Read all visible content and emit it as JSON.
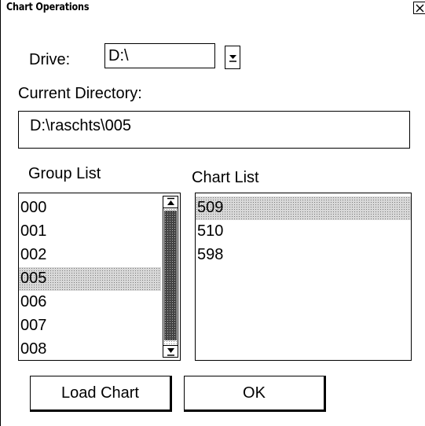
{
  "window": {
    "title": "Chart Operations"
  },
  "drive": {
    "label": "Drive:",
    "value": "D:\\",
    "dropdown_icon": "dropdown-arrow-icon"
  },
  "current_directory": {
    "label": "Current Directory:",
    "value": "D:\\raschts\\005"
  },
  "group_list": {
    "label": "Group List",
    "items": [
      "000",
      "001",
      "002",
      "005",
      "006",
      "007",
      "008"
    ],
    "selected_index": 3,
    "scroll_position": 0.35
  },
  "chart_list": {
    "label": "Chart List",
    "items": [
      "509",
      "510",
      "598"
    ],
    "selected_index": 0
  },
  "buttons": {
    "load_chart": "Load Chart",
    "ok": "OK"
  }
}
